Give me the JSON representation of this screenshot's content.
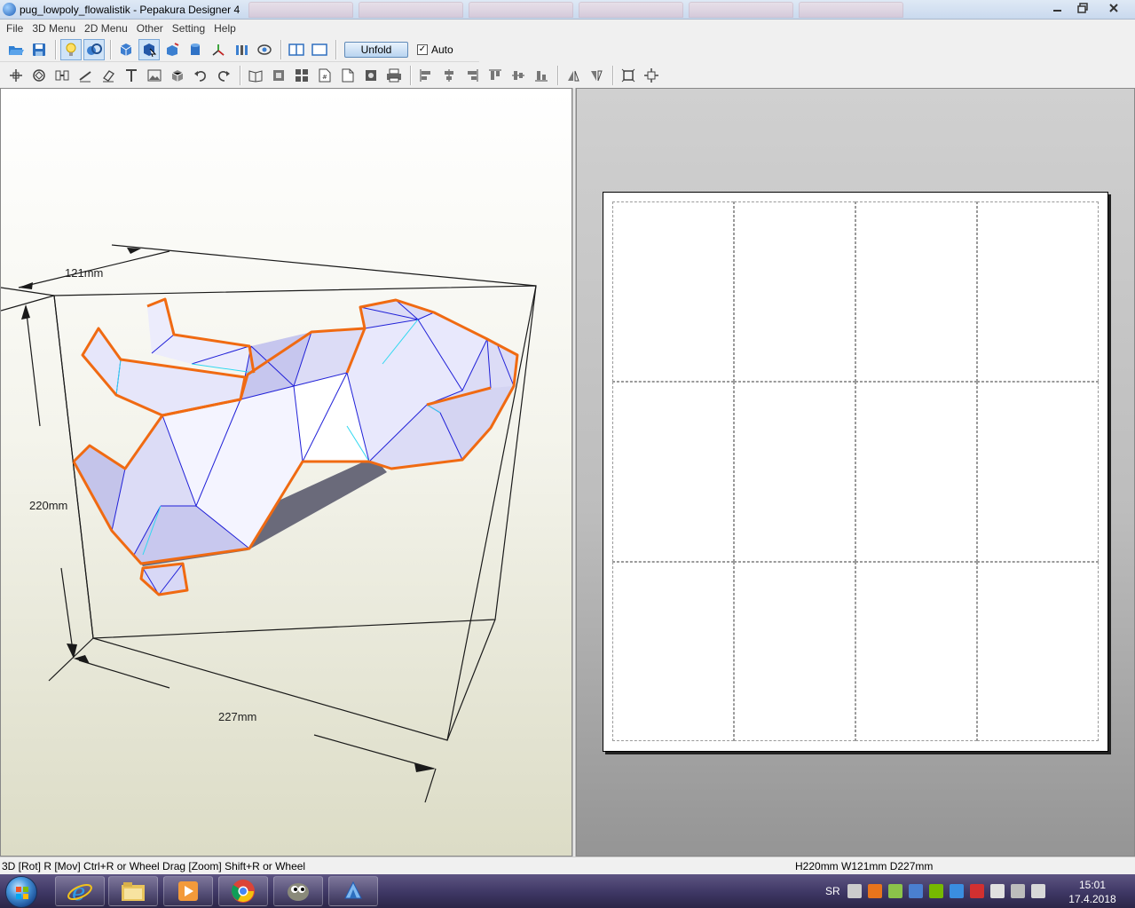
{
  "window": {
    "title": "pug_lowpoly_flowalistik - Pepakura Designer 4",
    "icon": "pepakura-app-icon",
    "controls": [
      "minimize",
      "restore",
      "close"
    ]
  },
  "menu": {
    "items": [
      {
        "label": "File"
      },
      {
        "label": "3D Menu"
      },
      {
        "label": "2D Menu"
      },
      {
        "label": "Other"
      },
      {
        "label": "Setting"
      },
      {
        "label": "Help"
      }
    ]
  },
  "toolbar1": {
    "unfold_label": "Unfold",
    "auto_label": "Auto",
    "auto_checked": true,
    "icons": [
      "open-file-icon",
      "save-icon",
      "light-bulb-icon",
      "texture-icon",
      "rotate-model-icon",
      "select-face-icon",
      "paint-icon",
      "cylinder-icon",
      "axis-icon",
      "bar-icon",
      "view-icon",
      "layout-split-icon",
      "layout-single-icon"
    ]
  },
  "toolbar2": {
    "icons": [
      "move-icon",
      "rotate-icon",
      "join-icon",
      "line-icon",
      "eraser-icon",
      "text-icon",
      "image-icon",
      "box-icon",
      "undo-icon",
      "redo-icon",
      "book-icon",
      "frame-icon",
      "grid-icon",
      "page-icon",
      "page-add-icon",
      "camera-icon",
      "print-icon",
      "align-left-icon",
      "align-center-icon",
      "align-right-icon",
      "align-top-icon",
      "align-middle-icon",
      "align-bottom-icon",
      "flip-icon",
      "flip2-icon",
      "fit-icon",
      "expand-icon"
    ]
  },
  "view3d": {
    "width_label": "121mm",
    "height_label": "220mm",
    "depth_label": "227mm",
    "model_fill": "#d8d8f4",
    "edge_cut_color": "#f06a12",
    "edge_fold_color": "#2020d8",
    "edge_glue_color": "#30d8f0"
  },
  "view2d": {
    "sheet_columns": 4,
    "sheet_rows": 3
  },
  "status": {
    "left": "3D [Rot] R [Mov] Ctrl+R or Wheel Drag [Zoom] Shift+R or Wheel",
    "right": "H220mm W121mm D227mm"
  },
  "taskbar": {
    "apps": [
      "internet-explorer-icon",
      "file-explorer-icon",
      "media-player-icon",
      "chrome-icon",
      "gimp-icon",
      "pepakura-icon"
    ],
    "tray_lang": "SR",
    "clock_time": "15:01",
    "clock_date": "17.4.2018"
  }
}
